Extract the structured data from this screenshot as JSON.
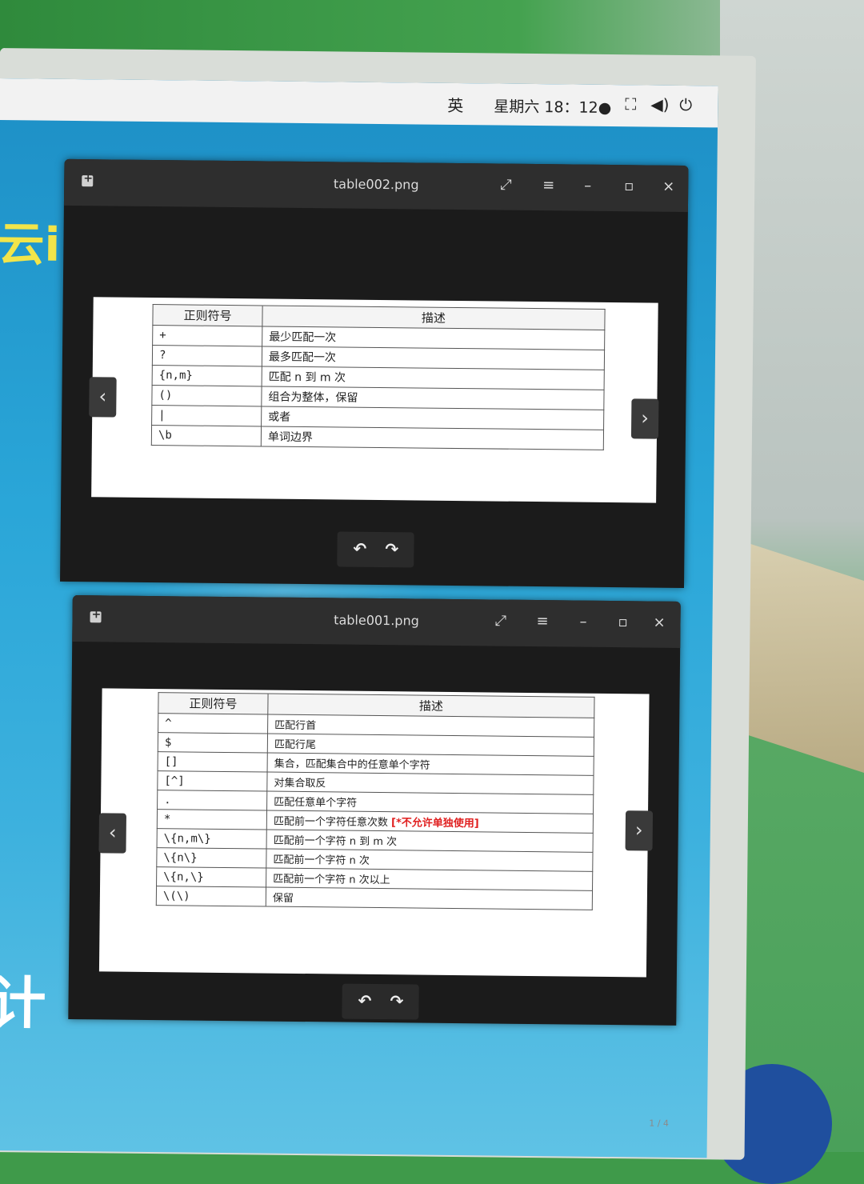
{
  "system_bar": {
    "input_method": "英",
    "clock": "星期六 18：12●",
    "icons": [
      "network-icon",
      "volume-icon",
      "power-icon"
    ]
  },
  "background_slide": {
    "fragment_1": "云i",
    "fragment_2": "计",
    "page_indicator": "1 / 4"
  },
  "viewer_top": {
    "title": "table002.png",
    "header_symbol": "正则符号",
    "header_desc": "描述",
    "rows": [
      {
        "symbol": "+",
        "desc": "最少匹配一次"
      },
      {
        "symbol": "?",
        "desc": "最多匹配一次"
      },
      {
        "symbol": "{n,m}",
        "desc": "匹配 n 到 m 次"
      },
      {
        "symbol": "()",
        "desc": "组合为整体，保留"
      },
      {
        "symbol": "|",
        "desc": "或者"
      },
      {
        "symbol": "\\b",
        "desc": "单词边界"
      }
    ]
  },
  "viewer_bottom": {
    "title": "table001.png",
    "header_symbol": "正则符号",
    "header_desc": "描述",
    "rows": [
      {
        "symbol": "^",
        "desc": "匹配行首"
      },
      {
        "symbol": "$",
        "desc": "匹配行尾"
      },
      {
        "symbol": "[]",
        "desc": "集合，匹配集合中的任意单个字符"
      },
      {
        "symbol": "[^]",
        "desc": "对集合取反"
      },
      {
        "symbol": ".",
        "desc": "匹配任意单个字符"
      },
      {
        "symbol": "*",
        "desc": "匹配前一个字符任意次数",
        "note": "[*不允许单独使用]"
      },
      {
        "symbol": "\\{n,m\\}",
        "desc": "匹配前一个字符 n 到 m 次"
      },
      {
        "symbol": "\\{n\\}",
        "desc": "匹配前一个字符 n 次"
      },
      {
        "symbol": "\\{n,\\}",
        "desc": "匹配前一个字符 n 次以上"
      },
      {
        "symbol": "\\(\\)",
        "desc": "保留"
      }
    ]
  },
  "viewer_controls": {
    "fullscreen": "⤢",
    "menu": "≡",
    "minimize": "–",
    "maximize": "▫",
    "close": "×",
    "prev": "‹",
    "next": "›",
    "rotate_left": "↶",
    "rotate_right": "↷"
  },
  "colors": {
    "desktop_blue": "#2aa6d8",
    "viewer_dark": "#1b1b1b",
    "titlebar": "#2e2e2e",
    "warning_red": "#e02020"
  }
}
